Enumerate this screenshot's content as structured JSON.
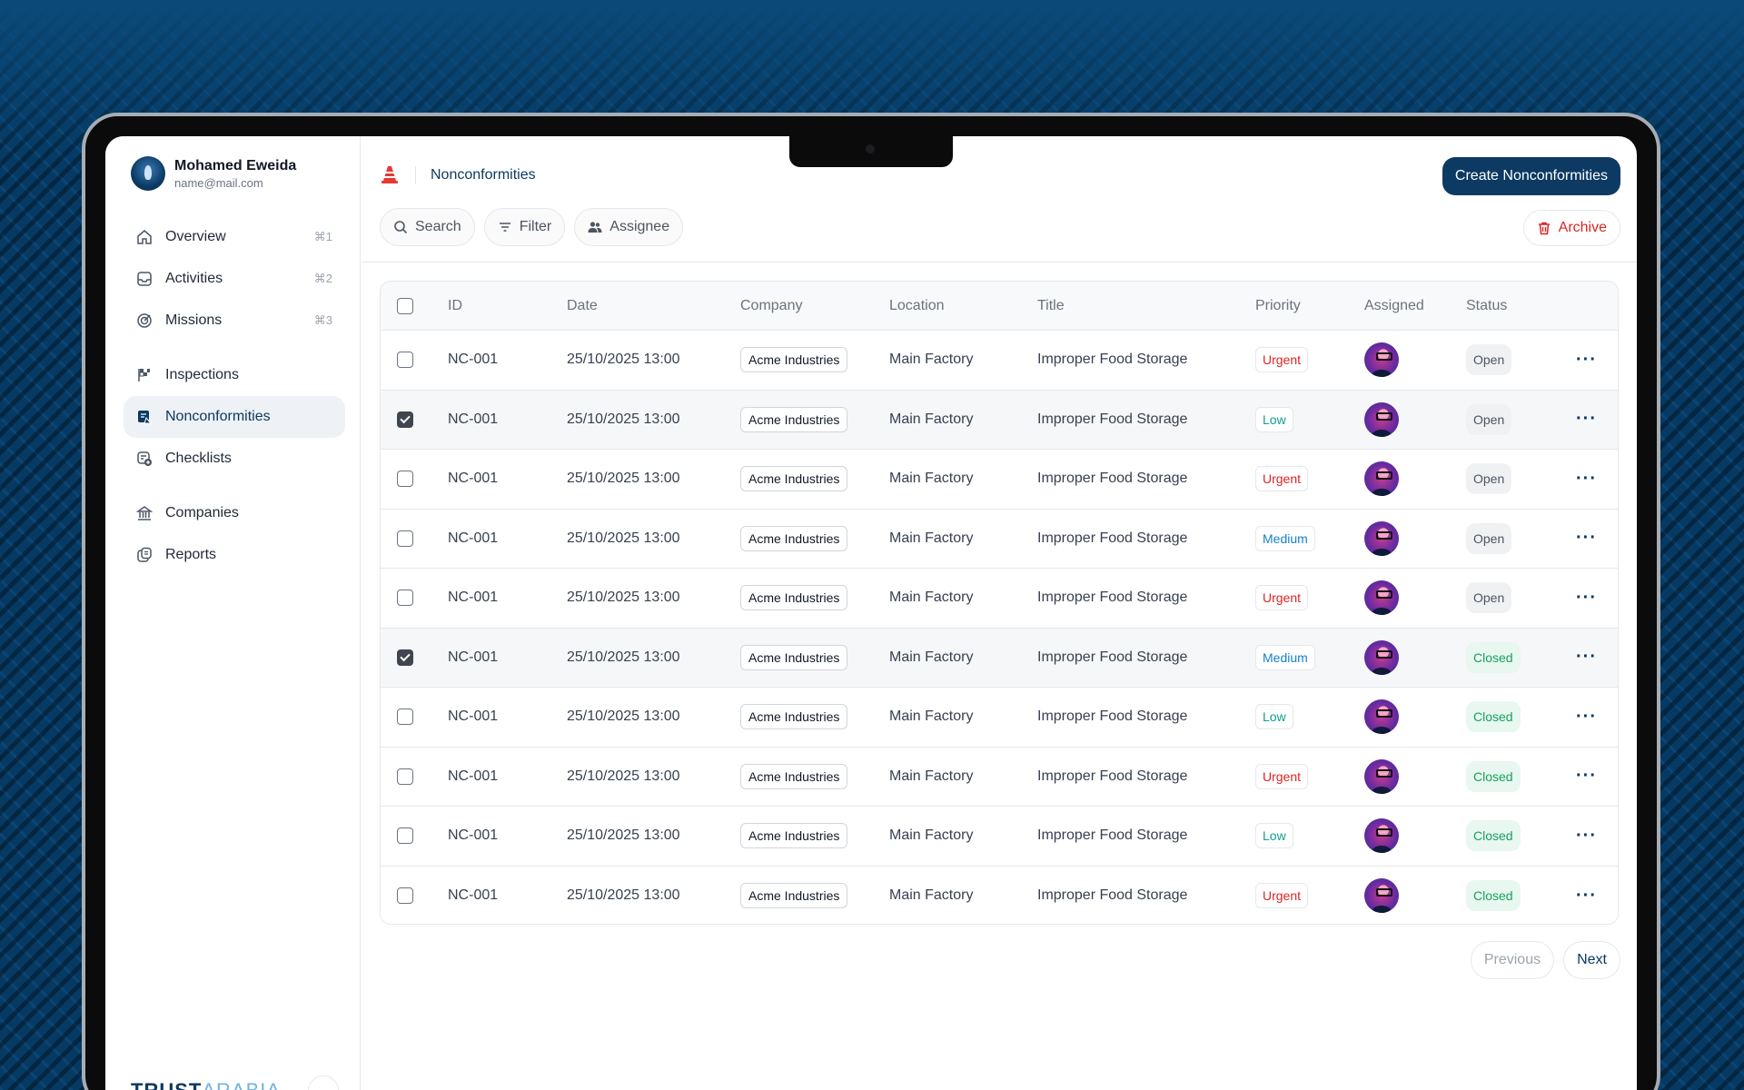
{
  "user": {
    "name": "Mohamed Eweida",
    "email": "name@mail.com"
  },
  "sidebar": {
    "groups": [
      [
        {
          "label": "Overview",
          "icon": "home-icon",
          "shortcut": "⌘1"
        },
        {
          "label": "Activities",
          "icon": "inbox-icon",
          "shortcut": "⌘2"
        },
        {
          "label": "Missions",
          "icon": "target-icon",
          "shortcut": "⌘3"
        }
      ],
      [
        {
          "label": "Inspections",
          "icon": "checkered-flag-icon"
        },
        {
          "label": "Nonconformities",
          "icon": "nonconformity-icon",
          "active": true
        },
        {
          "label": "Checklists",
          "icon": "checklist-icon"
        }
      ],
      [
        {
          "label": "Companies",
          "icon": "bank-icon"
        },
        {
          "label": "Reports",
          "icon": "reports-icon"
        }
      ]
    ],
    "brand_primary": "TRUST",
    "brand_secondary": "ARABIA"
  },
  "header": {
    "breadcrumb": "Nonconformities",
    "create_label": "Create Nonconformities"
  },
  "toolbar": {
    "search_label": "Search",
    "filter_label": "Filter",
    "assignee_label": "Assignee",
    "archive_label": "Archive"
  },
  "table": {
    "columns": [
      "ID",
      "Date",
      "Company",
      "Location",
      "Title",
      "Priority",
      "Assigned",
      "Status"
    ],
    "rows": [
      {
        "selected": false,
        "id": "NC-001",
        "date": "25/10/2025 13:00",
        "company": "Acme Industries",
        "location": "Main Factory",
        "title": "Improper Food Storage",
        "priority": "Urgent",
        "status": "Open"
      },
      {
        "selected": true,
        "id": "NC-001",
        "date": "25/10/2025 13:00",
        "company": "Acme Industries",
        "location": "Main Factory",
        "title": "Improper Food Storage",
        "priority": "Low",
        "status": "Open"
      },
      {
        "selected": false,
        "id": "NC-001",
        "date": "25/10/2025 13:00",
        "company": "Acme Industries",
        "location": "Main Factory",
        "title": "Improper Food Storage",
        "priority": "Urgent",
        "status": "Open"
      },
      {
        "selected": false,
        "id": "NC-001",
        "date": "25/10/2025 13:00",
        "company": "Acme Industries",
        "location": "Main Factory",
        "title": "Improper Food Storage",
        "priority": "Medium",
        "status": "Open"
      },
      {
        "selected": false,
        "id": "NC-001",
        "date": "25/10/2025 13:00",
        "company": "Acme Industries",
        "location": "Main Factory",
        "title": "Improper Food Storage",
        "priority": "Urgent",
        "status": "Open"
      },
      {
        "selected": true,
        "id": "NC-001",
        "date": "25/10/2025 13:00",
        "company": "Acme Industries",
        "location": "Main Factory",
        "title": "Improper Food Storage",
        "priority": "Medium",
        "status": "Closed"
      },
      {
        "selected": false,
        "id": "NC-001",
        "date": "25/10/2025 13:00",
        "company": "Acme Industries",
        "location": "Main Factory",
        "title": "Improper Food Storage",
        "priority": "Low",
        "status": "Closed"
      },
      {
        "selected": false,
        "id": "NC-001",
        "date": "25/10/2025 13:00",
        "company": "Acme Industries",
        "location": "Main Factory",
        "title": "Improper Food Storage",
        "priority": "Urgent",
        "status": "Closed"
      },
      {
        "selected": false,
        "id": "NC-001",
        "date": "25/10/2025 13:00",
        "company": "Acme Industries",
        "location": "Main Factory",
        "title": "Improper Food Storage",
        "priority": "Low",
        "status": "Closed"
      },
      {
        "selected": false,
        "id": "NC-001",
        "date": "25/10/2025 13:00",
        "company": "Acme Industries",
        "location": "Main Factory",
        "title": "Improper Food Storage",
        "priority": "Urgent",
        "status": "Closed"
      }
    ]
  },
  "pagination": {
    "previous_label": "Previous",
    "next_label": "Next"
  },
  "colors": {
    "brand": "#0c3a63",
    "urgent": "#dc2626",
    "low": "#0e9f8f",
    "medium": "#1582c4",
    "closed": "#17a05d",
    "background": "#063a63"
  }
}
